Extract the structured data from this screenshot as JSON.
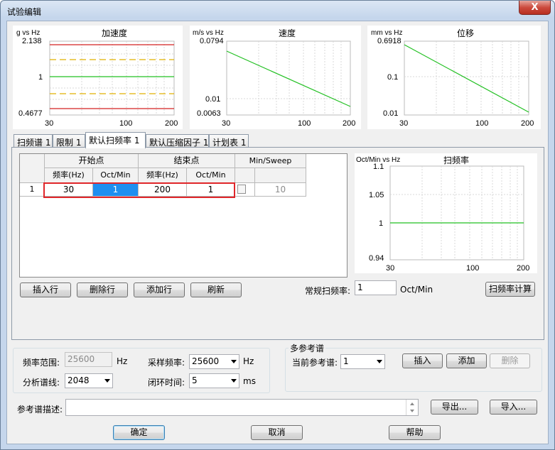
{
  "window": {
    "title": "试验编辑",
    "close_glyph": "X"
  },
  "charts": [
    {
      "unit": "g vs Hz",
      "title": "加速度",
      "y_top": "2.138",
      "y_mid": "1",
      "y_bottom": "0.4677",
      "x_ticks": [
        "30",
        "100",
        "200"
      ]
    },
    {
      "unit": "m/s vs Hz",
      "title": "速度",
      "y_top": "0.0794",
      "y_mid": "0.01",
      "y_bottom": "0.0063",
      "x_ticks": [
        "30",
        "100",
        "200"
      ]
    },
    {
      "unit": "mm vs Hz",
      "title": "位移",
      "y_top": "0.6918",
      "y_mid": "0.1",
      "y_bottom": "0.01",
      "x_ticks": [
        "30",
        "100",
        "200"
      ]
    }
  ],
  "tabs": [
    "扫频谱 1",
    "限制 1",
    "默认扫频率 1",
    "默认压缩因子 1",
    "计划表 1"
  ],
  "grid": {
    "group_start": "开始点",
    "group_end": "结束点",
    "group_min": "Min/Sweep",
    "col_freq": "频率(Hz)",
    "col_oct": "Oct/Min",
    "row": {
      "index": "1",
      "start_freq": "30",
      "start_oct": "1",
      "end_freq": "200",
      "end_oct": "1",
      "min_sweep": "10"
    }
  },
  "rate_chart": {
    "unit": "Oct/Min vs Hz",
    "title": "扫频率",
    "y_ticks": [
      "1.1",
      "1.05",
      "1",
      "0.94"
    ],
    "x_ticks": [
      "30",
      "100",
      "200"
    ]
  },
  "buttons": {
    "insert_row": "插入行",
    "delete_row": "删除行",
    "add_row": "添加行",
    "refresh": "刷新",
    "calc_rate": "扫频率计算",
    "insert": "插入",
    "add": "添加",
    "delete": "删除",
    "export": "导出...",
    "import": "导入...",
    "ok": "确定",
    "cancel": "取消",
    "help": "帮助"
  },
  "rate": {
    "label": "常规扫频率:",
    "value": "1",
    "unit": "Oct/Min"
  },
  "settings": {
    "freq_range_label": "频率范围:",
    "freq_range_value": "25600",
    "freq_range_unit": "Hz",
    "sample_rate_label": "采样频率:",
    "sample_rate_value": "25600",
    "sample_rate_unit": "Hz",
    "lines_label": "分析谱线:",
    "lines_value": "2048",
    "loop_time_label": "闭环时间:",
    "loop_time_value": "5",
    "loop_time_unit": "ms"
  },
  "multi_ref": {
    "title": "多参考谱",
    "current_label": "当前参考谱:",
    "current_value": "1"
  },
  "ref_desc": {
    "label": "参考谱描述:",
    "value": ""
  }
}
